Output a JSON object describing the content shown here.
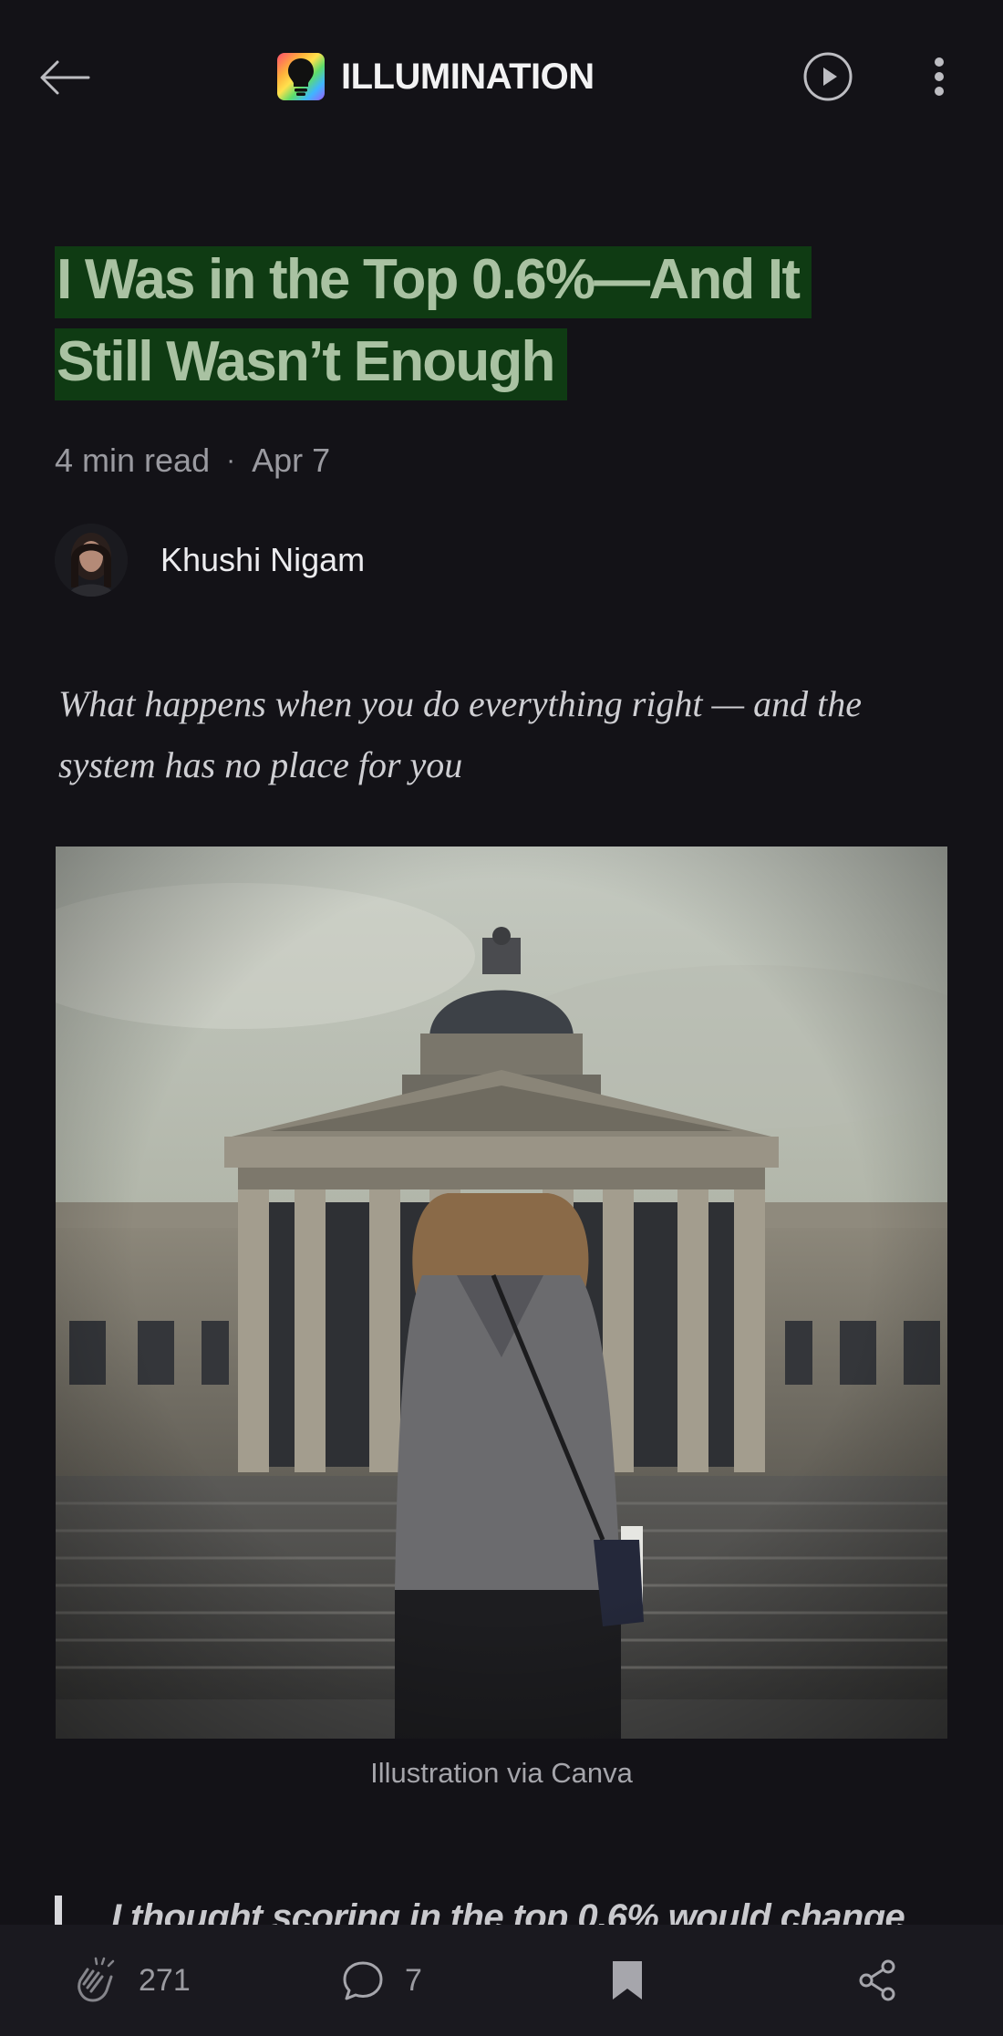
{
  "header": {
    "publication_name": "ILLUMINATION",
    "back_icon": "arrow-left-icon",
    "play_icon": "play-circle-icon",
    "more_icon": "more-vertical-icon"
  },
  "article": {
    "title_line1": "I Was in the Top 0.6%—And It",
    "title_line2": "Still Wasn’t Enough",
    "read_time": "4 min read",
    "separator": "·",
    "date": "Apr 7",
    "author_name": "Khushi Nigam",
    "subtitle": "What happens when you do everything right — and the system has no place for you",
    "image_caption": "Illustration via Canva",
    "quote_preview": "I thought scoring in the top 0.6% would change"
  },
  "footer": {
    "claps": "271",
    "comments": "7",
    "clap_icon": "clap-icon",
    "comment_icon": "comment-icon",
    "bookmark_icon": "bookmark-icon",
    "share_icon": "share-icon"
  },
  "colors": {
    "background": "#131217",
    "title_text": "#a9c2a2",
    "title_highlight": "#0f3b13",
    "bottom_bar": "#1a191f"
  }
}
